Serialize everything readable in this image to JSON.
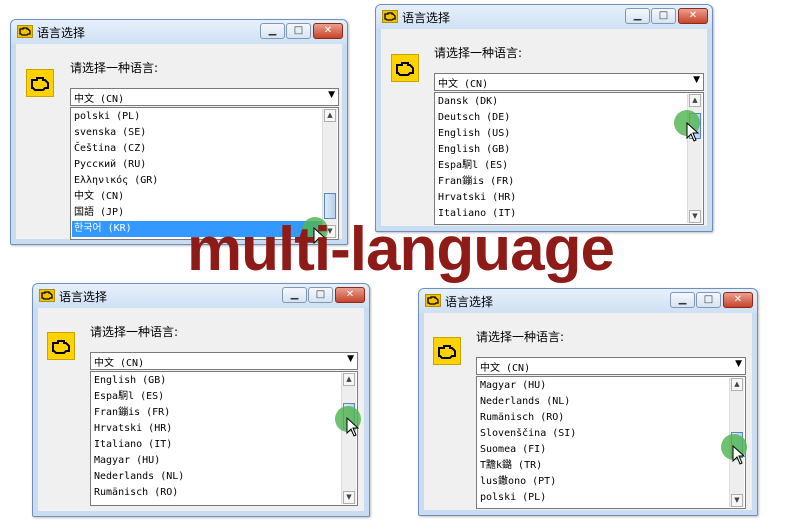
{
  "banner_text": "multi-language",
  "accent_color": "#8e1b17",
  "selection_color": "#3399ff",
  "window_title": "语言选择",
  "prompt_text": "请选择一种语言:",
  "combo_value": "中文 (CN)",
  "icons": {
    "app": "engine-check-icon",
    "minimize": "minimize-icon",
    "maximize": "maximize-icon",
    "close": "close-icon",
    "dropdown": "chevron-down-icon",
    "cursor": "mouse-pointer-icon"
  },
  "windows": [
    {
      "title": "语言选择",
      "prompt": "请选择一种语言:",
      "combo": "中文 (CN)",
      "items": [
        "polski (PL)",
        "svenska (SE)",
        "Čeština (CZ)",
        "Русский (RU)",
        "Ελληνικός (GR)",
        "中文 (CN)",
        "国語 (JP)",
        "한국어 (KR)"
      ],
      "selected_index": 7
    },
    {
      "title": "语言选择",
      "prompt": "请选择一种语言:",
      "combo": "中文 (CN)",
      "items": [
        "Dansk (DK)",
        "Deutsch (DE)",
        "English (US)",
        "English (GB)",
        "Espa駉l (ES)",
        "Fran鏰is (FR)",
        "Hrvatski (HR)",
        "Italiano (IT)"
      ],
      "selected_index": -1
    },
    {
      "title": "语言选择",
      "prompt": "请选择一种语言:",
      "combo": "中文 (CN)",
      "items": [
        "English (GB)",
        "Espa駉l (ES)",
        "Fran鏰is (FR)",
        "Hrvatski (HR)",
        "Italiano (IT)",
        "Magyar (HU)",
        "Nederlands (NL)",
        "Rumänisch (RO)"
      ],
      "selected_index": -1
    },
    {
      "title": "语言选择",
      "prompt": "请选择一种语言:",
      "combo": "中文 (CN)",
      "items": [
        "Magyar (HU)",
        "Nederlands (NL)",
        "Rumänisch (RO)",
        "Slovenščina (SI)",
        "Suomea (FI)",
        "T黵k鏴 (TR)",
        "lus鏾ono (PT)",
        "polski (PL)"
      ],
      "selected_index": -1
    }
  ]
}
